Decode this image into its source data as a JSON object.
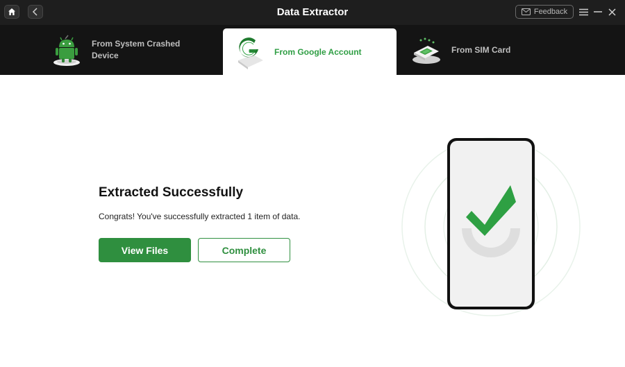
{
  "window": {
    "title": "Data Extractor",
    "feedback_label": "Feedback"
  },
  "tabs": [
    {
      "label": "From System Crashed Device",
      "icon": "android-robot-icon",
      "active": false
    },
    {
      "label": "From Google Account",
      "icon": "google-g-icon",
      "active": true
    },
    {
      "label": "From SIM Card",
      "icon": "sim-card-icon",
      "active": false
    }
  ],
  "main": {
    "headline": "Extracted Successfully",
    "message": "Congrats! You've successfully extracted 1 item of data.",
    "view_files_label": "View Files",
    "complete_label": "Complete"
  },
  "colors": {
    "accent": "#2f8f3f",
    "titlebar": "#1e1e1e",
    "tabbar": "#141414"
  }
}
